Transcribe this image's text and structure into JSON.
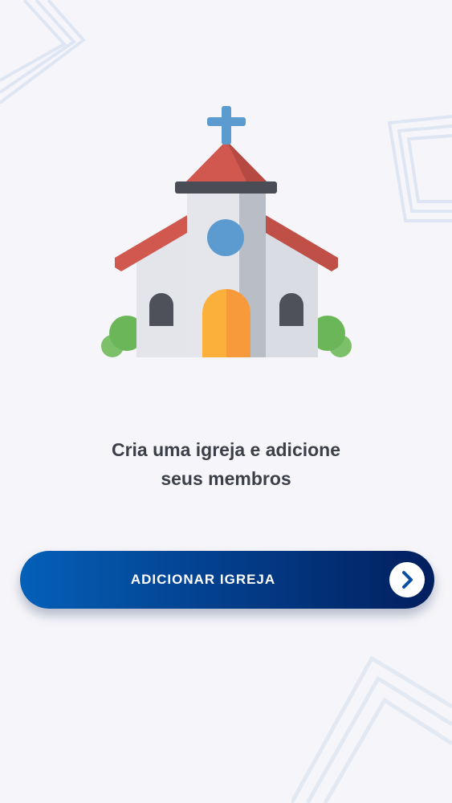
{
  "onboarding": {
    "headline_line1": "Cria uma igreja e adicione",
    "headline_line2": "seus membros"
  },
  "cta": {
    "label": "ADICIONAR IGREJA",
    "icon": "chevron-right-icon"
  },
  "illustration": {
    "icon": "church-icon"
  },
  "colors": {
    "background": "#f6f6fa",
    "button_start": "#0460b8",
    "button_end": "#021f5e",
    "roof": "#d0584f",
    "cross": "#5b9bd0"
  }
}
